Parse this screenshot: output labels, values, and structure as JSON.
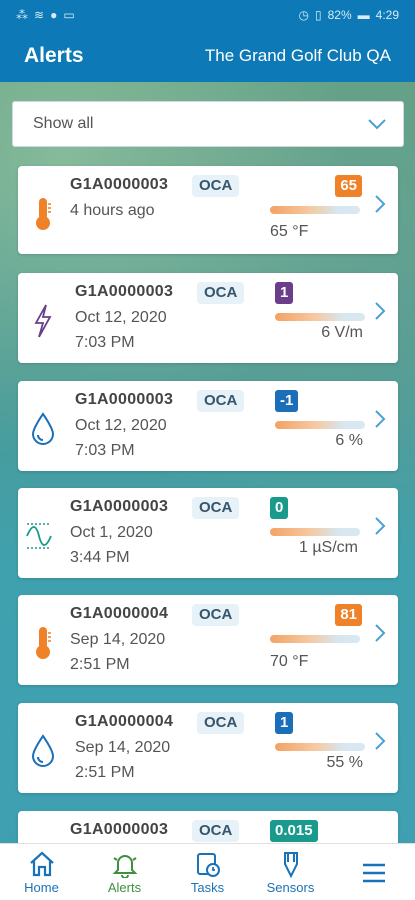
{
  "status_bar": {
    "battery": "82%",
    "time": "4:29"
  },
  "header": {
    "title": "Alerts",
    "club": "The Grand Golf Club QA"
  },
  "filter": {
    "value": "Show all"
  },
  "alerts": [
    {
      "icon": "thermometer-icon",
      "sensor": "G1A0000003",
      "tag": "OCA",
      "line1": "4 hours ago",
      "line2": "",
      "badge": "65",
      "badge_color": "#ef8128",
      "reading": "65 °F"
    },
    {
      "icon": "lightning-icon",
      "sensor": "G1A0000003",
      "tag": "OCA",
      "line1": "Oct 12, 2020",
      "line2": "7:03 PM",
      "badge": "1",
      "badge_color": "#6b3e8c",
      "reading": "6 V/m"
    },
    {
      "icon": "water-drop-icon",
      "sensor": "G1A0000003",
      "tag": "OCA",
      "line1": "Oct 12, 2020",
      "line2": "7:03 PM",
      "badge": "-1",
      "badge_color": "#1a6fb8",
      "reading": "6 %"
    },
    {
      "icon": "conductivity-icon",
      "sensor": "G1A0000003",
      "tag": "OCA",
      "line1": "Oct 1, 2020",
      "line2": "3:44 PM",
      "badge": "0",
      "badge_color": "#199a8c",
      "reading": "1 µS/cm"
    },
    {
      "icon": "thermometer-icon",
      "sensor": "G1A0000004",
      "tag": "OCA",
      "line1": "Sep 14, 2020",
      "line2": "2:51 PM",
      "badge": "81",
      "badge_color": "#ef8128",
      "reading": "70 °F"
    },
    {
      "icon": "water-drop-icon",
      "sensor": "G1A0000004",
      "tag": "OCA",
      "line1": "Sep 14, 2020",
      "line2": "2:51 PM",
      "badge": "1",
      "badge_color": "#1a6fb8",
      "reading": "55 %"
    },
    {
      "icon": "conductivity-icon",
      "sensor": "G1A0000003",
      "tag": "OCA",
      "line1": "",
      "line2": "",
      "badge": "0.015",
      "badge_color": "#199a8c",
      "reading": ""
    }
  ],
  "nav": {
    "home": "Home",
    "alerts": "Alerts",
    "tasks": "Tasks",
    "sensors": "Sensors"
  },
  "colors": {
    "brand": "#0d79b7",
    "active_nav": "#3f8f3f"
  }
}
